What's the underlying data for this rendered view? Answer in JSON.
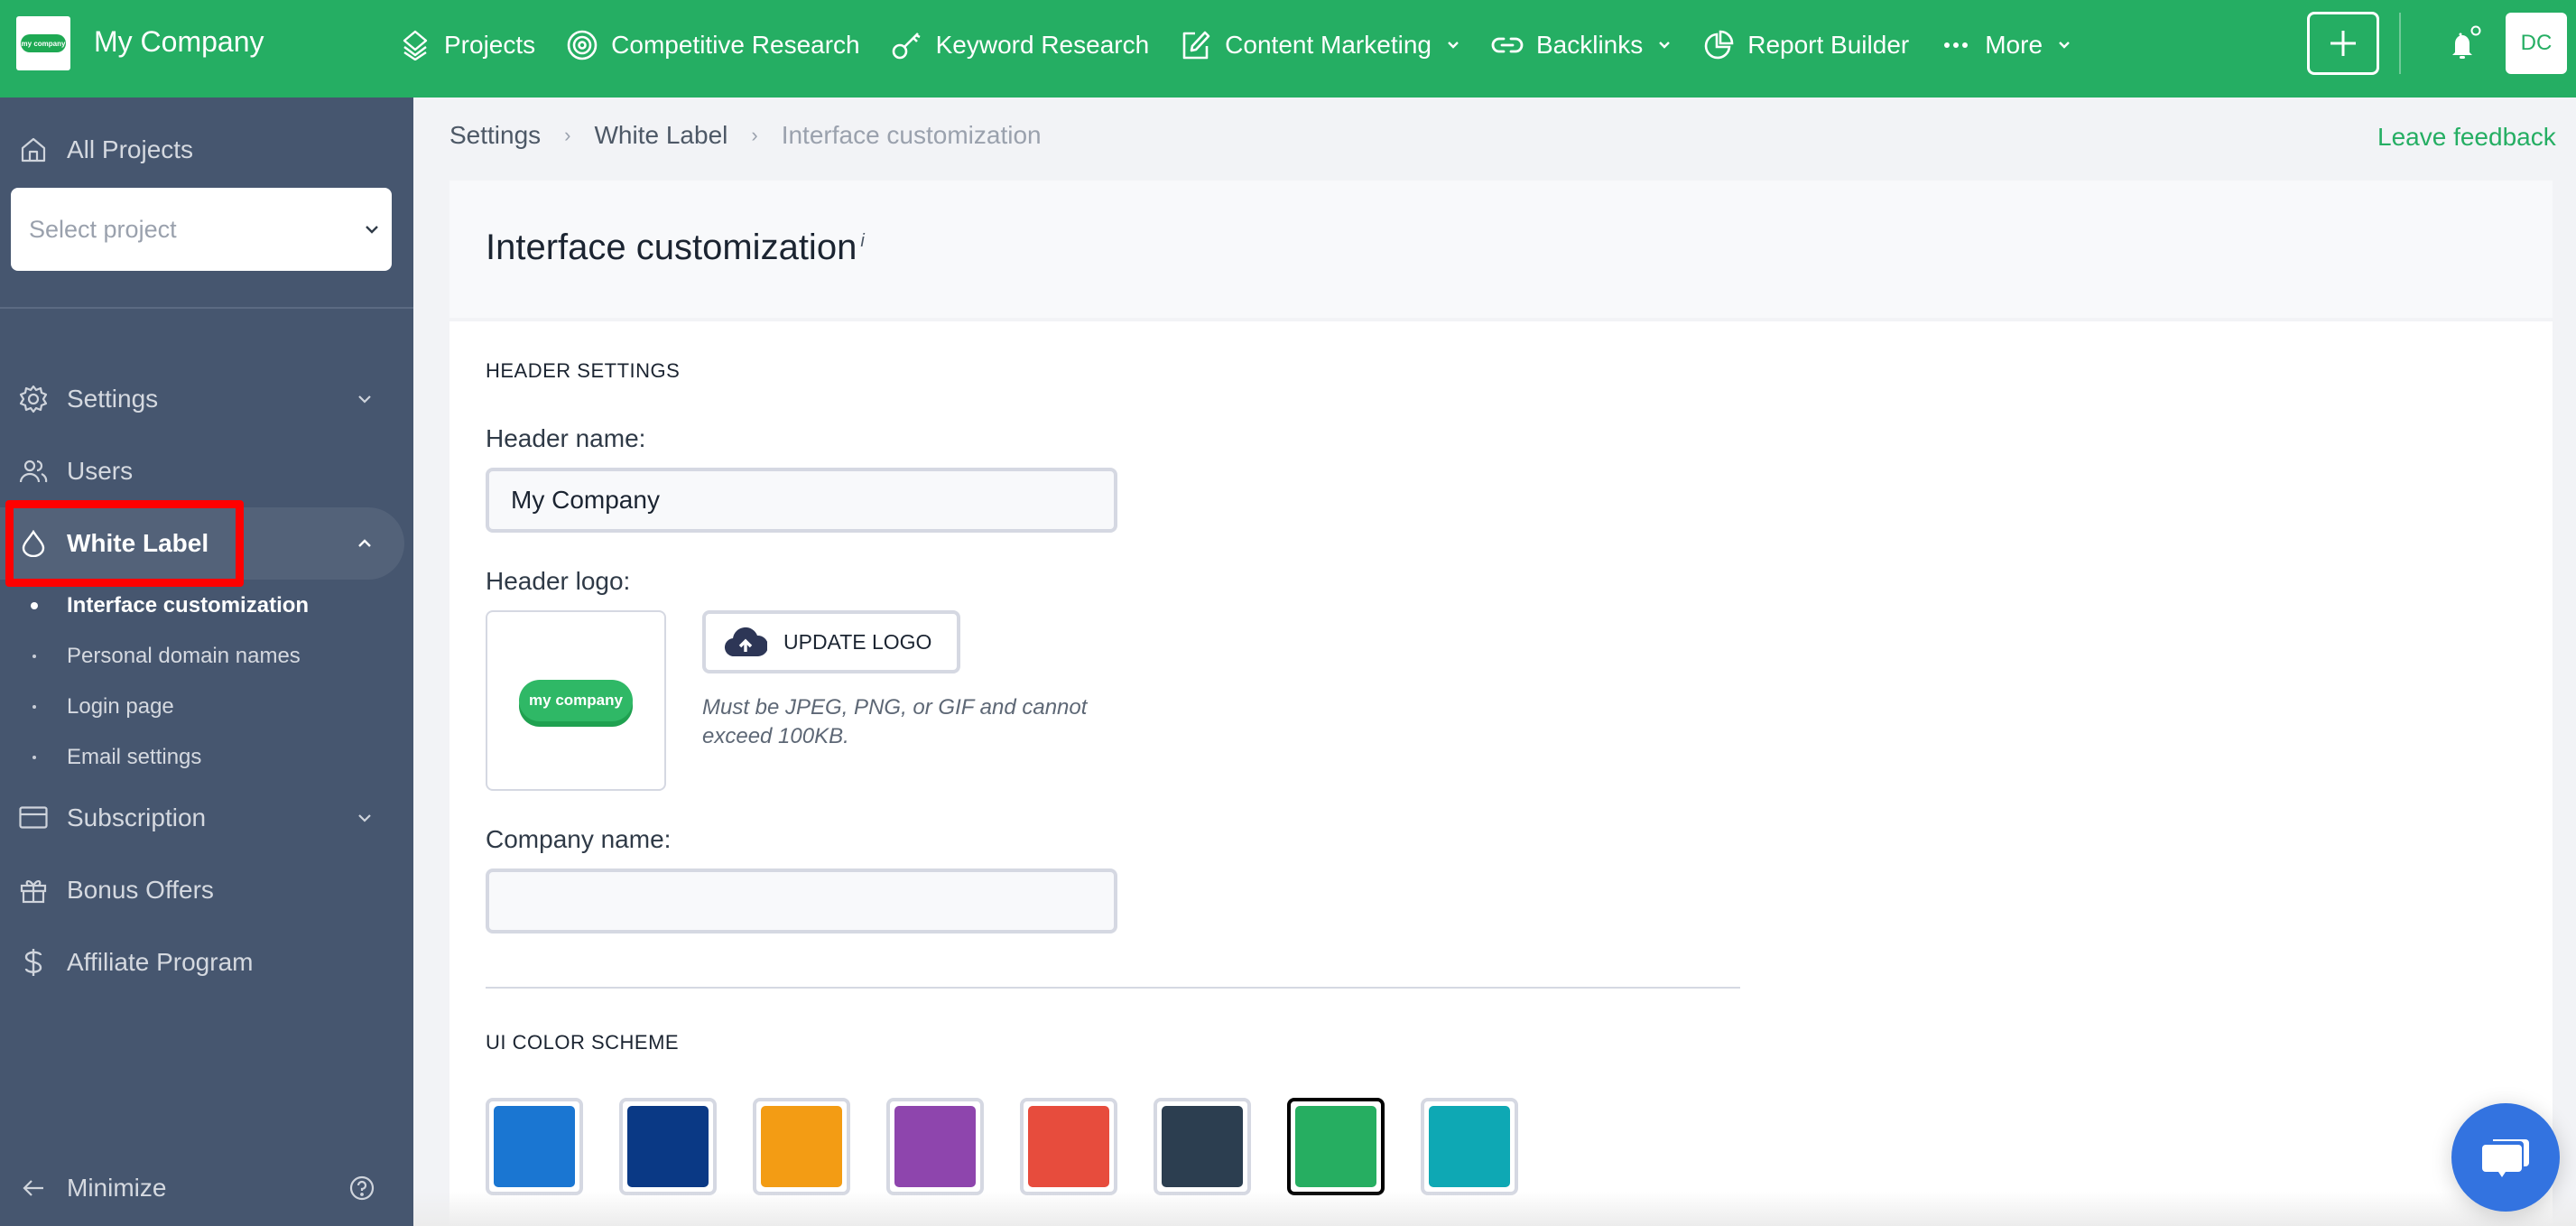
{
  "topbar": {
    "brand_name": "My Company",
    "logo_text": "my company",
    "nav": [
      {
        "label": "Projects",
        "icon": "layers-icon",
        "has_dropdown": false
      },
      {
        "label": "Competitive Research",
        "icon": "target-icon",
        "has_dropdown": false
      },
      {
        "label": "Keyword Research",
        "icon": "key-icon",
        "has_dropdown": false
      },
      {
        "label": "Content Marketing",
        "icon": "edit-icon",
        "has_dropdown": true
      },
      {
        "label": "Backlinks",
        "icon": "link-icon",
        "has_dropdown": true
      },
      {
        "label": "Report Builder",
        "icon": "pie-chart-icon",
        "has_dropdown": false
      },
      {
        "label": "More",
        "icon": "more-dots-icon",
        "has_dropdown": true
      }
    ],
    "add_button_icon": "plus-icon",
    "notification_icon": "bell-icon",
    "avatar_initials": "DC",
    "brand_color": "#25ae63"
  },
  "sidebar": {
    "all_projects": "All Projects",
    "select_project_placeholder": "Select project",
    "items": [
      {
        "label": "Settings",
        "icon": "gear-icon",
        "expandable": true
      },
      {
        "label": "Users",
        "icon": "users-icon",
        "expandable": false
      },
      {
        "label": "White Label",
        "icon": "droplet-icon",
        "expandable": true,
        "expanded": true,
        "active": true
      },
      {
        "label": "Subscription",
        "icon": "credit-card-icon",
        "expandable": true
      },
      {
        "label": "Bonus Offers",
        "icon": "gift-icon",
        "expandable": false
      },
      {
        "label": "Affiliate Program",
        "icon": "dollar-icon",
        "expandable": false
      }
    ],
    "white_label_sub": [
      {
        "label": "Interface customization",
        "active": true
      },
      {
        "label": "Personal domain names",
        "active": false
      },
      {
        "label": "Login page",
        "active": false
      },
      {
        "label": "Email settings",
        "active": false
      }
    ],
    "minimize": "Minimize",
    "help_icon": "help-circle-icon",
    "highlight_color": "#ff0000"
  },
  "breadcrumb": {
    "items": [
      "Settings",
      "White Label"
    ],
    "current": "Interface customization",
    "separator": "›"
  },
  "feedback_link": "Leave feedback",
  "page": {
    "title": "Interface customization",
    "title_info": "i",
    "header_settings": {
      "section_title": "HEADER SETTINGS",
      "header_name_label": "Header name:",
      "header_name_value": "My Company",
      "header_logo_label": "Header logo:",
      "update_logo_label": "UPDATE LOGO",
      "logo_hint": "Must be JPEG, PNG, or GIF and cannot exceed 100KB.",
      "company_name_label": "Company name:",
      "company_name_value": ""
    },
    "color_scheme": {
      "section_title": "UI COLOR SCHEME",
      "swatches": [
        {
          "color": "#1a76d2",
          "selected": false
        },
        {
          "color": "#0a3985",
          "selected": false
        },
        {
          "color": "#f39c14",
          "selected": false
        },
        {
          "color": "#8e45ad",
          "selected": false
        },
        {
          "color": "#e74c3d",
          "selected": false
        },
        {
          "color": "#2c3e50",
          "selected": false
        },
        {
          "color": "#26ae61",
          "selected": true
        },
        {
          "color": "#0ea8b4",
          "selected": false
        }
      ]
    }
  },
  "chat_widget_icon": "chat-bubbles-icon"
}
